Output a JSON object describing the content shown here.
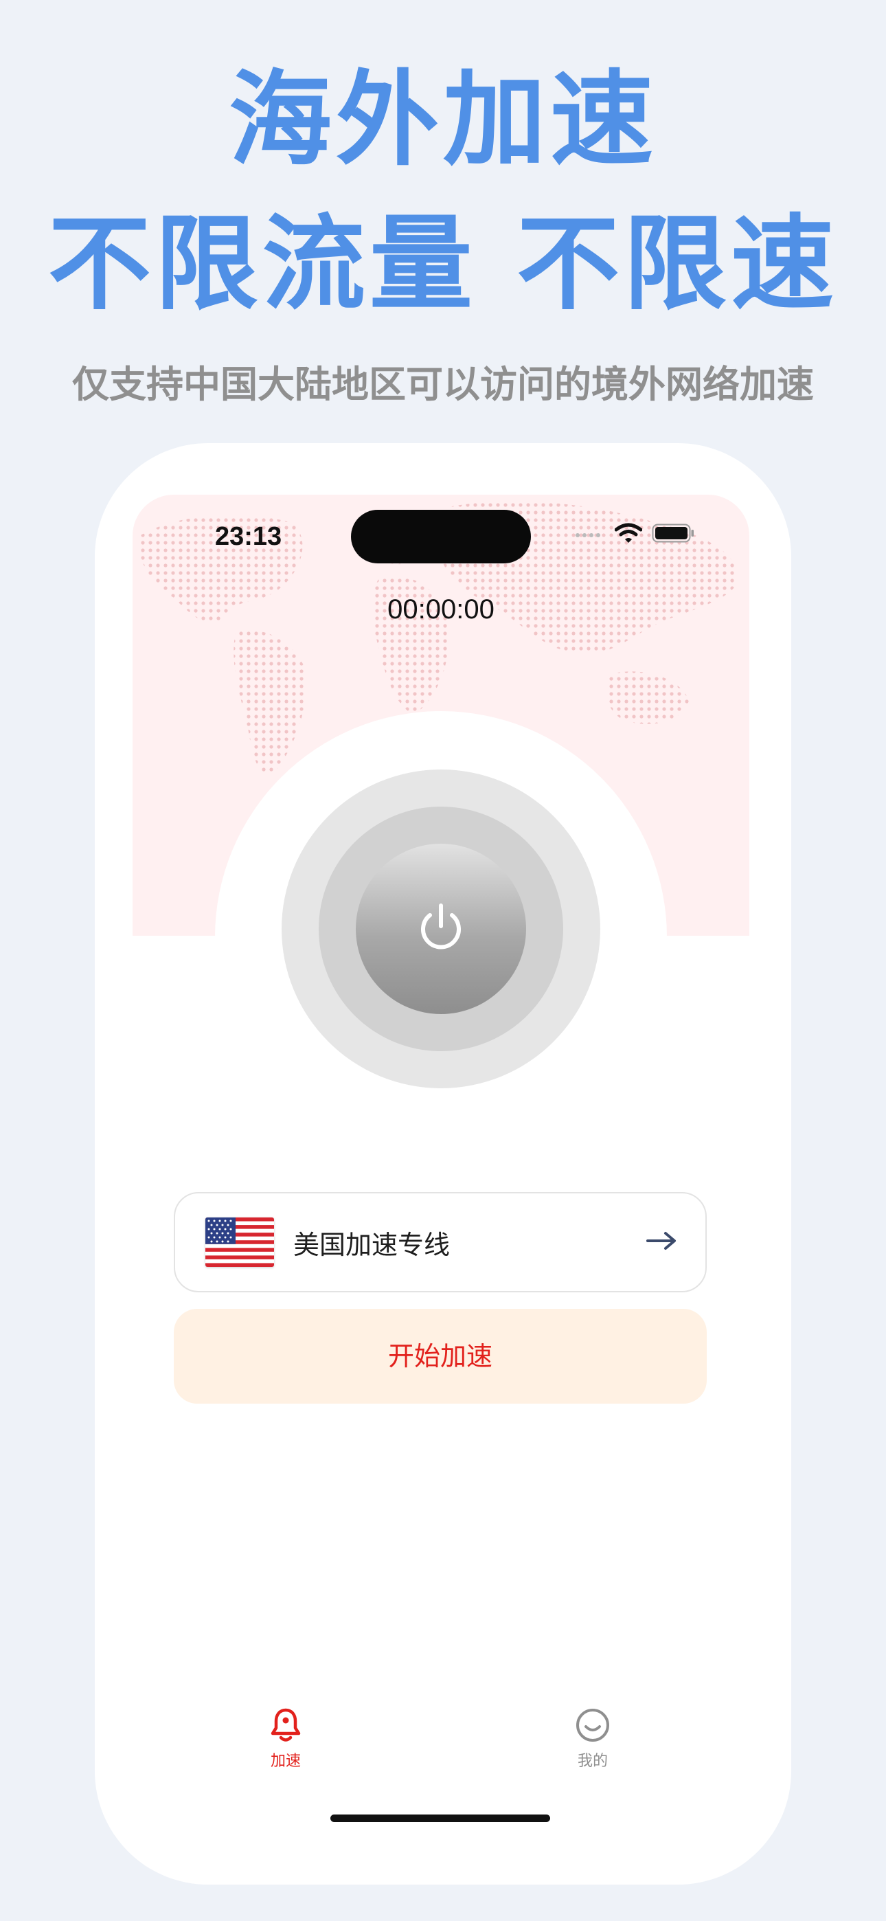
{
  "promo": {
    "title_line1": "海外加速",
    "title_line2": "不限流量 不限速",
    "subtitle": "仅支持中国大陆地区可以访问的境外网络加速"
  },
  "status_bar": {
    "time": "23:13"
  },
  "connection": {
    "timer": "00:00:00"
  },
  "server": {
    "label": "美国加速专线",
    "flag": "us-flag-icon"
  },
  "actions": {
    "start_label": "开始加速"
  },
  "tabbar": {
    "tabs": [
      {
        "label": "加速",
        "icon": "bell-icon",
        "active": true
      },
      {
        "label": "我的",
        "icon": "smiley-icon",
        "active": false
      }
    ]
  },
  "colors": {
    "headline": "#5090e6",
    "accent_red": "#e2211c",
    "start_button_bg": "#fff1e3",
    "page_bg": "#eef2f8"
  }
}
